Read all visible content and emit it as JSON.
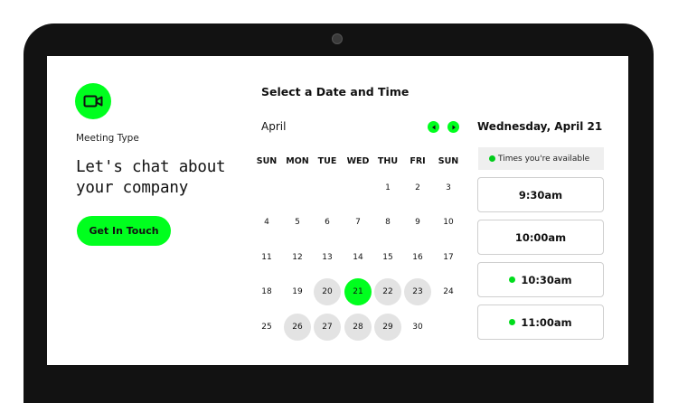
{
  "meeting": {
    "icon": "video-camera-icon",
    "type_label": "Meeting Type",
    "headline_line1": "Let's chat about",
    "headline_line2": "your company",
    "cta_label": "Get In Touch"
  },
  "calendar": {
    "title": "Select a Date and Time",
    "month": "April",
    "weekdays": [
      "SUN",
      "MON",
      "TUE",
      "WED",
      "THU",
      "FRI",
      "SUN"
    ],
    "weeks": [
      [
        null,
        null,
        null,
        null,
        "1",
        "2",
        "3"
      ],
      [
        "4",
        "5",
        "6",
        "7",
        "8",
        "9",
        "10"
      ],
      [
        "11",
        "12",
        "13",
        "14",
        "15",
        "16",
        "17"
      ],
      [
        "18",
        "19",
        "20",
        "21",
        "22",
        "23",
        "24"
      ],
      [
        "25",
        "26",
        "27",
        "28",
        "29",
        "30",
        null
      ]
    ],
    "available_days": [
      "20",
      "22",
      "23",
      "26",
      "27",
      "28",
      "29"
    ],
    "selected_day": "21"
  },
  "times": {
    "date_heading": "Wednesday, April 21",
    "legend_label": "Times you're available",
    "slots": [
      {
        "label": "9:30am",
        "available": false
      },
      {
        "label": "10:00am",
        "available": false
      },
      {
        "label": "10:30am",
        "available": true
      },
      {
        "label": "11:00am",
        "available": true
      }
    ]
  },
  "colors": {
    "accent": "#00ff1e",
    "bezel": "#121212",
    "available_day_bg": "#e3e3e3"
  }
}
